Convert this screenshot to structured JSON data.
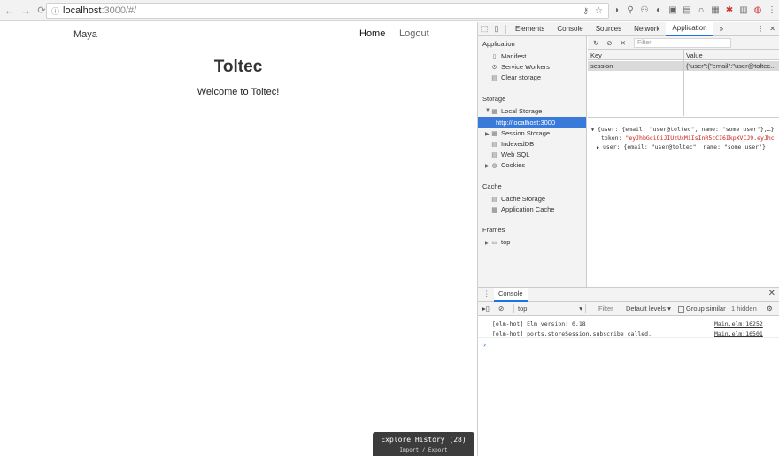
{
  "browser": {
    "url_host": "localhost",
    "url_path": ":3000/#/",
    "back_icon": "←",
    "forward_icon": "→",
    "reload_icon": "C"
  },
  "app": {
    "brand": "Maya",
    "nav_home": "Home",
    "nav_logout": "Logout",
    "title": "Toltec",
    "welcome": "Welcome to Toltec!",
    "explore_title": "Explore History (28)",
    "explore_sub": "Import / Export"
  },
  "devtools": {
    "tabs": [
      "Elements",
      "Console",
      "Sources",
      "Network",
      "Application"
    ],
    "active_tab": "Application",
    "more": "»",
    "sidebar": {
      "application_head": "Application",
      "application_items": [
        "Manifest",
        "Service Workers",
        "Clear storage"
      ],
      "storage_head": "Storage",
      "local_storage": "Local Storage",
      "local_storage_origin": "http://localhost:3000",
      "storage_items": [
        "Session Storage",
        "IndexedDB",
        "Web SQL",
        "Cookies"
      ],
      "cache_head": "Cache",
      "cache_items": [
        "Cache Storage",
        "Application Cache"
      ],
      "frames_head": "Frames",
      "frame_top": "top"
    },
    "storage_table": {
      "filter_placeholder": "Filter",
      "key_header": "Key",
      "value_header": "Value",
      "row_key": "session",
      "row_value": "{\"user\":{\"email\":\"user@toltec..."
    },
    "preview": {
      "line1": "{user: {email: \"user@toltec\", name: \"some user\"},…}",
      "token_label": "token: ",
      "token_value": "\"eyJhbGciOiJIUzUxMiIsInR5cCI6IkpXVCJ9.eyJhc",
      "line3": "user: {email: \"user@toltec\", name: \"some user\"}"
    },
    "console": {
      "tab": "Console",
      "context": "top",
      "filter": "Filter",
      "levels": "Default levels",
      "group_similar": "Group similar",
      "hidden": "1 hidden",
      "logs": [
        {
          "msg": "[elm-hot] Elm version: 0.18",
          "src": "Main.elm:16252"
        },
        {
          "msg": "[elm-hot] ports.storeSession.subscribe called.",
          "src": "Main.elm:16501"
        }
      ],
      "prompt": "›"
    }
  }
}
